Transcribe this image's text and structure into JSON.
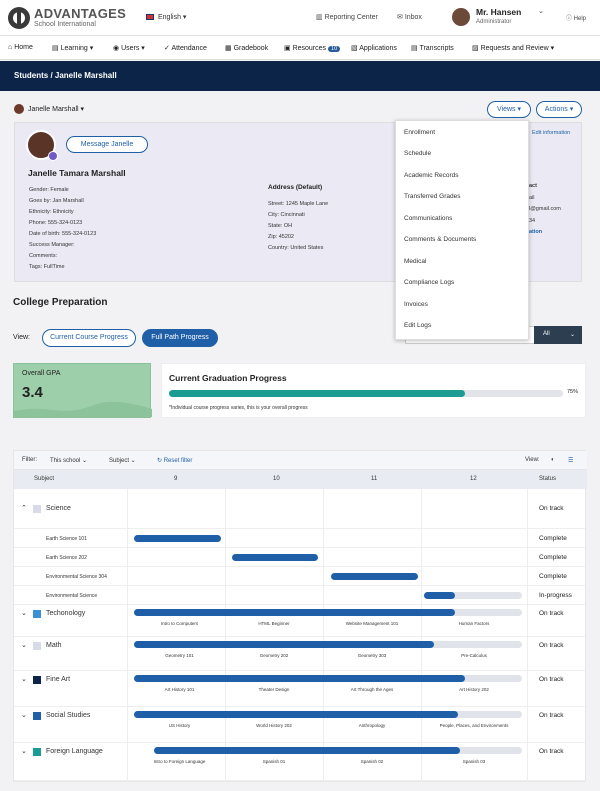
{
  "header": {
    "logo": "ADVANTAGES",
    "logo_sub": "School International",
    "language": "English",
    "reporting": "Reporting Center",
    "inbox": "Inbox",
    "user_name": "Mr. Hansen",
    "user_role": "Administrator",
    "help": "Help"
  },
  "nav": [
    "Home",
    "Learning",
    "Users",
    "Attendance",
    "Gradebook",
    "Resources",
    "Applications",
    "Transcripts",
    "Requests and Review"
  ],
  "nav_badge": "10",
  "breadcrumb": "Students / Janelle Marshall",
  "student_select": "Janelle Marshall",
  "views_btn": "Views",
  "actions_btn": "Actions",
  "message_btn": "Message Janelle",
  "full_name": "Janelle Tamara Marshall",
  "edit_info": "Edit information",
  "details": [
    "Gender:    Female",
    "Goes by:    Jan Marshall",
    "Ethnicity:   Ethnicity",
    "Phone:      555-324-0123",
    "Date of birth:    555-324-0123",
    "Success Manager:",
    "",
    "Comments:",
    "",
    "Tags: FullTime"
  ],
  "address": {
    "title": "Address (Default)",
    "lines": [
      "Street: 1245 Maple Lane",
      "City:      Cincinnati",
      "State:    OH",
      "Zip:       45202",
      "Country:  United States"
    ]
  },
  "contact_frag": [
    "act",
    "ail",
    "l@gmail.com",
    "34",
    "",
    "",
    "ation"
  ],
  "dropdown": [
    "Enrollment",
    "Schedule",
    "Academic Records",
    "Transferred Grades",
    "Communications",
    "Comments & Documents",
    "Medical",
    "Compliance Logs",
    "Invoices",
    "Edit Logs"
  ],
  "section_title": "College Preparation",
  "view_label": "View:",
  "view_buttons": [
    "Current Course Progress",
    "Full Path Progress"
  ],
  "all_select": "All",
  "gpa": {
    "label": "Overall GPA",
    "value": "3.4"
  },
  "graduation": {
    "title": "Current Graduation Progress",
    "percent": "75%",
    "progress": 0.75,
    "note": "*Individual course progress varies, this is  your overall progress"
  },
  "filter": {
    "label": "Filter:",
    "school": "This school",
    "subject": "Subject",
    "reset": "Reset filter",
    "view": "View:"
  },
  "columns": [
    "Subject",
    "9",
    "10",
    "11",
    "12",
    "Status"
  ],
  "rows": [
    {
      "subject": "Science",
      "status": "On track",
      "color": "#d7dbe8",
      "expanded": true
    },
    {
      "subject": "Earth Science 101",
      "status": "Complete"
    },
    {
      "subject": "Earth Science 202",
      "status": "Complete"
    },
    {
      "subject": "Environmental Science 304",
      "status": "Complete"
    },
    {
      "subject": "Environmental Science",
      "status": "In-progress"
    },
    {
      "subject": "Techonology",
      "status": "On track",
      "color": "#3b8fd4",
      "labels": [
        "Intro to Computers",
        "HTML Beginner",
        "Website Management 101",
        "Human Factors"
      ]
    },
    {
      "subject": "Math",
      "status": "On track",
      "color": "#d7dbe8",
      "labels": [
        "Geometry 101",
        "Geometry 202",
        "Geometry 303",
        "Pre-Calculus"
      ]
    },
    {
      "subject": "Fine Art",
      "status": "On track",
      "color": "#0b2447",
      "labels": [
        "Art History 101",
        "Theater Design",
        "Art Through the Ages",
        "Art History 202"
      ]
    },
    {
      "subject": "Social Studies",
      "status": "On track",
      "color": "#1f5fa8",
      "labels": [
        "US History",
        "World History 202",
        "Anthropology",
        "People, Places, and Environments"
      ]
    },
    {
      "subject": "Foreign Language",
      "status": "On track",
      "color": "#1b9c93",
      "labels": [
        "Intro to Foreign Language",
        "Spanish 01",
        "Spanish 02",
        "Spanish 03"
      ]
    }
  ]
}
